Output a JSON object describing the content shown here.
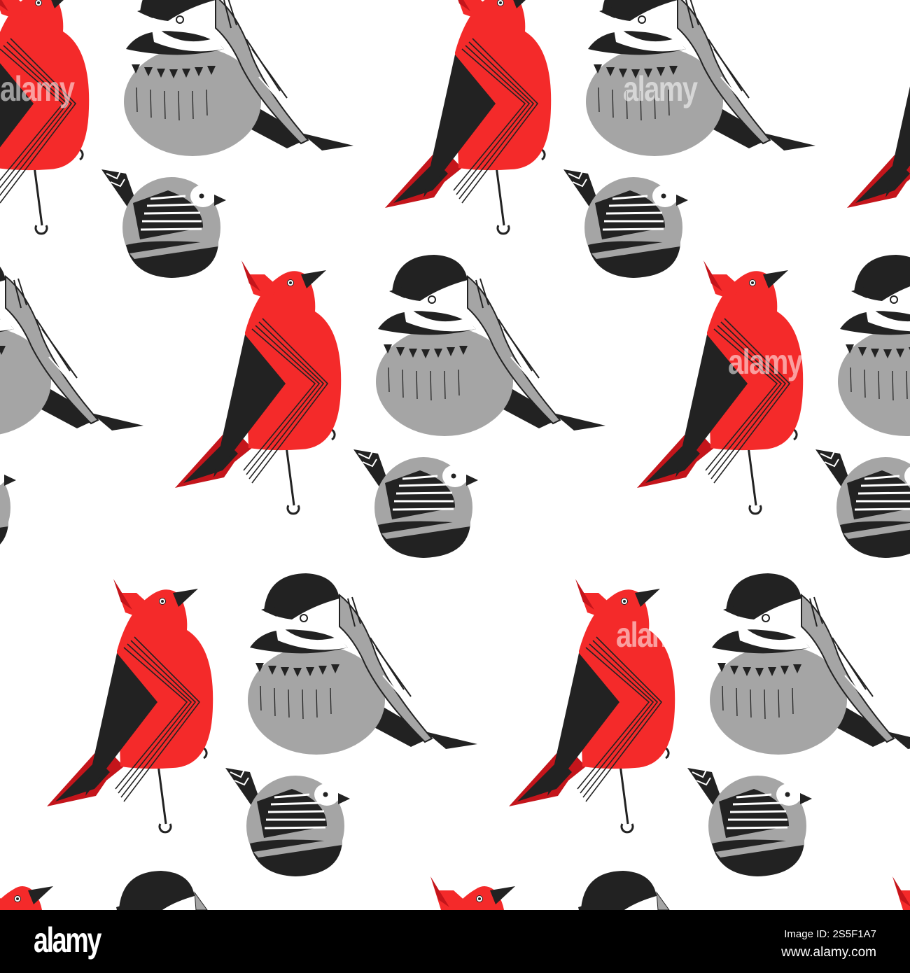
{
  "image": {
    "subject": "Seamless pattern of cardinal, chickadee and sparrow birds",
    "colors": {
      "red": "#f42a2a",
      "dark_red": "#c4151b",
      "black": "#222222",
      "gray": "#a5a5a5",
      "white": "#ffffff"
    }
  },
  "watermark": {
    "text": "alamy"
  },
  "footer": {
    "logo": "alamy",
    "image_id": "Image ID: 2S5F1A7",
    "url": "www.alamy.com"
  }
}
